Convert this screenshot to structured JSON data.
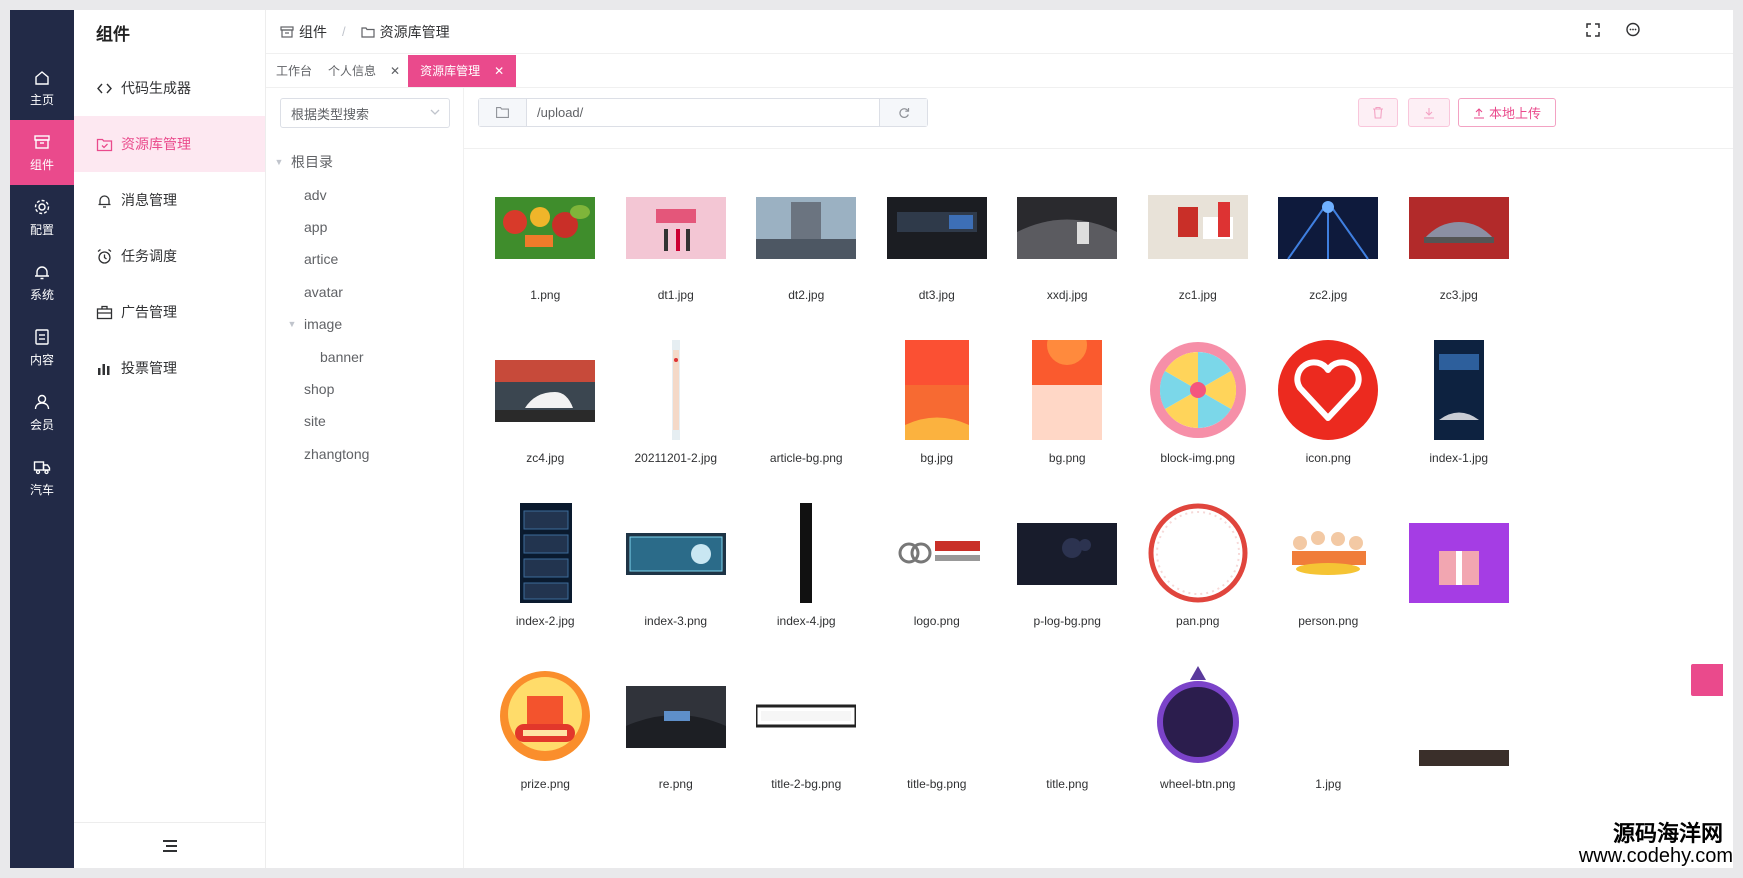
{
  "rail": [
    {
      "label": "主页",
      "icon": "home-icon"
    },
    {
      "label": "组件",
      "icon": "archive-icon",
      "active": true
    },
    {
      "label": "配置",
      "icon": "gear-icon"
    },
    {
      "label": "系统",
      "icon": "bell-icon"
    },
    {
      "label": "内容",
      "icon": "document-icon"
    },
    {
      "label": "会员",
      "icon": "user-icon"
    },
    {
      "label": "汽车",
      "icon": "truck-icon"
    }
  ],
  "sidebar": {
    "title": "组件",
    "items": [
      {
        "label": "代码生成器",
        "icon": "code-icon"
      },
      {
        "label": "资源库管理",
        "icon": "folder-check-icon",
        "active": true
      },
      {
        "label": "消息管理",
        "icon": "bell-icon"
      },
      {
        "label": "任务调度",
        "icon": "alarm-clock-icon"
      },
      {
        "label": "广告管理",
        "icon": "briefcase-icon"
      },
      {
        "label": "投票管理",
        "icon": "bar-chart-icon"
      }
    ]
  },
  "breadcrumb": {
    "parent": "组件",
    "current": "资源库管理"
  },
  "tabs": [
    {
      "label": "工作台",
      "closable": false
    },
    {
      "label": "个人信息",
      "closable": true
    },
    {
      "label": "资源库管理",
      "closable": true,
      "active": true
    }
  ],
  "tree": {
    "select_placeholder": "根据类型搜索",
    "root": "根目录",
    "nodes": [
      {
        "label": "adv",
        "level": 1
      },
      {
        "label": "app",
        "level": 1
      },
      {
        "label": "artice",
        "level": 1
      },
      {
        "label": "avatar",
        "level": 1
      },
      {
        "label": "image",
        "level": 1,
        "expanded": true
      },
      {
        "label": "banner",
        "level": 2
      },
      {
        "label": "shop",
        "level": 1
      },
      {
        "label": "site",
        "level": 1
      },
      {
        "label": "zhangtong",
        "level": 1
      }
    ]
  },
  "toolbar": {
    "path": "/upload/",
    "upload_label": "本地上传"
  },
  "colors": {
    "accent": "#ea4a8c",
    "rail": "#222a47"
  },
  "files": [
    {
      "name": "1.png",
      "thumb": "vegetables"
    },
    {
      "name": "dt1.jpg",
      "thumb": "stage-pink"
    },
    {
      "name": "dt2.jpg",
      "thumb": "building"
    },
    {
      "name": "dt3.jpg",
      "thumb": "dashboard-dark"
    },
    {
      "name": "xxdj.jpg",
      "thumb": "car-interior"
    },
    {
      "name": "zc1.jpg",
      "thumb": "office"
    },
    {
      "name": "zc2.jpg",
      "thumb": "stage-blue"
    },
    {
      "name": "zc3.jpg",
      "thumb": "car-red-stage"
    },
    {
      "name": "zc4.jpg",
      "thumb": "car-white"
    },
    {
      "name": "20211201-2.jpg",
      "thumb": "tall-strip"
    },
    {
      "name": "article-bg.png",
      "thumb": "blank"
    },
    {
      "name": "bg.jpg",
      "thumb": "orange-poster"
    },
    {
      "name": "bg.png",
      "thumb": "orange-rays"
    },
    {
      "name": "block-img.png",
      "thumb": "prize-wheel"
    },
    {
      "name": "icon.png",
      "thumb": "heart-circle"
    },
    {
      "name": "index-1.jpg",
      "thumb": "phone-poster"
    },
    {
      "name": "index-2.jpg",
      "thumb": "dark-cards"
    },
    {
      "name": "index-3.png",
      "thumb": "teal-panel"
    },
    {
      "name": "index-4.jpg",
      "thumb": "black-strip"
    },
    {
      "name": "logo.png",
      "thumb": "baic-logo"
    },
    {
      "name": "p-log-bg.png",
      "thumb": "dark-night"
    },
    {
      "name": "pan.png",
      "thumb": "ring"
    },
    {
      "name": "person.png",
      "thumb": "people-coins"
    },
    {
      "name": "",
      "thumb": "gift-purple"
    },
    {
      "name": "prize.png",
      "thumb": "prize-badge"
    },
    {
      "name": "re.png",
      "thumb": "car-interior-2"
    },
    {
      "name": "title-2-bg.png",
      "thumb": "frame-bar"
    },
    {
      "name": "title-bg.png",
      "thumb": "blank"
    },
    {
      "name": "title.png",
      "thumb": "blank"
    },
    {
      "name": "wheel-btn.png",
      "thumb": "purple-ring"
    },
    {
      "name": "1.jpg",
      "thumb": "blank"
    },
    {
      "name": "",
      "thumb": "dark-strip"
    }
  ],
  "watermark": {
    "line1": "源码海洋网",
    "line2": "www.codehy.com"
  }
}
